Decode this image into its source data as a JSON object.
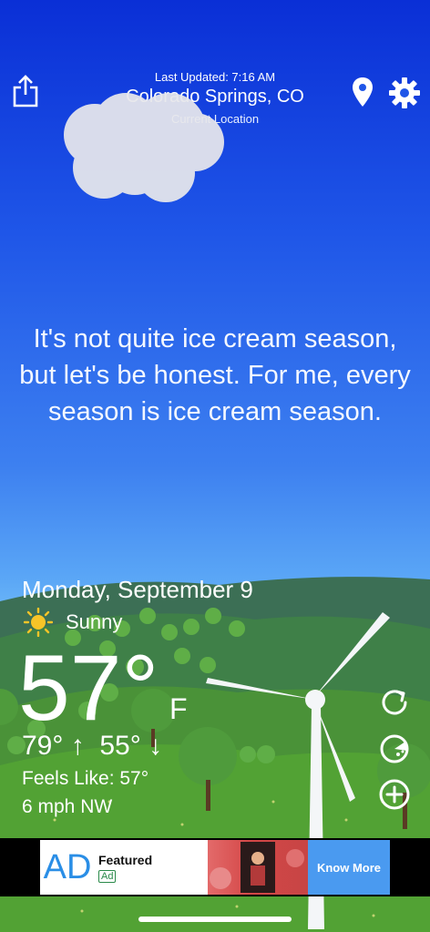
{
  "header": {
    "last_updated": "Last Updated: 7:16 AM",
    "city": "Colorado Springs, CO",
    "current_location": "Current Location",
    "share_icon": "share-icon",
    "location_icon": "location-pin-icon",
    "settings_icon": "gear-icon"
  },
  "quote": "It's not quite ice cream season, but let's be honest. For me, every season is ice cream season.",
  "weather": {
    "date": "Monday, September 9",
    "condition": "Sunny",
    "condition_icon": "sun-icon",
    "temperature": "57°",
    "unit": "F",
    "high": "79° ↑",
    "low": "55° ↓",
    "feels_like": "Feels Like: 57°",
    "wind": "6 mph NW"
  },
  "actions": {
    "refresh_icon": "refresh-icon",
    "radar_icon": "radar-icon",
    "add_icon": "add-location-icon"
  },
  "ad": {
    "logo": "AD",
    "featured": "Featured",
    "badge": "Ad",
    "cta": "Know More"
  },
  "colors": {
    "sky_top": "#0a2fd6",
    "sky_bottom": "#6db8f8",
    "hills": "#3f7a4f",
    "grass": "#4e9e36",
    "ad_cta": "#4a9af0"
  }
}
